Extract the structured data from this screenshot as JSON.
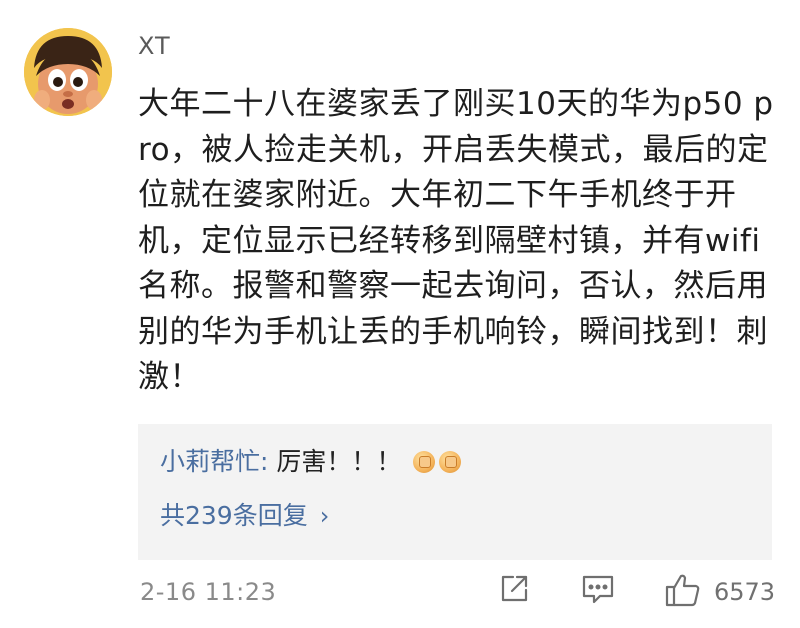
{
  "comment": {
    "username": "XT",
    "text": "大年二十八在婆家丢了刚买10天的华为p50 pro，被人捡走关机，开启丢失模式，最后的定位就在婆家附近。大年初二下午手机终于开机，定位显示已经转移到隔壁村镇，并有wifi名称。报警和警察一起去询问，否认，然后用别的华为手机让丢的手机响铃，瞬间找到！刺激！",
    "timestamp": "2-16 11:23",
    "like_count": "6573"
  },
  "reply": {
    "author": "小莉帮忙:",
    "content": " 厉害！！！",
    "emoji_icons": [
      "clap-icon",
      "clap-icon"
    ],
    "count_label": "共239条回复",
    "chevron": "›"
  },
  "icons": {
    "share": "share-icon",
    "comment": "comment-icon",
    "like": "thumbs-up-icon"
  },
  "colors": {
    "link_blue": "#4a6ea0",
    "reply_bg": "#f3f3f3",
    "meta_gray": "#8a8a8a"
  }
}
